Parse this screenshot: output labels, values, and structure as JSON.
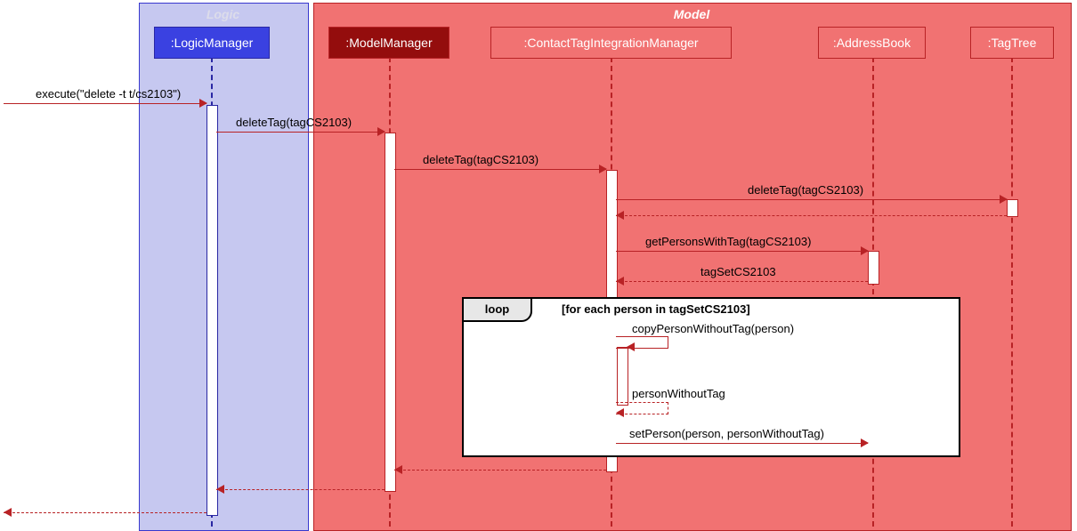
{
  "boxes": {
    "logic_title": "Logic",
    "model_title": "Model"
  },
  "participants": {
    "logic_manager": ":LogicManager",
    "model_manager": ":ModelManager",
    "cti_manager": ":ContactTagIntegrationManager",
    "address_book": ":AddressBook",
    "tag_tree": ":TagTree"
  },
  "messages": {
    "execute": "execute(\"delete -t t/cs2103\")",
    "delete_tag_1": "deleteTag(tagCS2103)",
    "delete_tag_2": "deleteTag(tagCS2103)",
    "delete_tag_3": "deleteTag(tagCS2103)",
    "get_persons": "getPersonsWithTag(tagCS2103)",
    "return_tagset": "tagSetCS2103",
    "copy_person": "copyPersonWithoutTag(person)",
    "return_pwt": "personWithoutTag",
    "set_person": "setPerson(person, personWithoutTag)"
  },
  "loop": {
    "label": "loop",
    "condition": "[for each person in tagSetCS2103]"
  }
}
